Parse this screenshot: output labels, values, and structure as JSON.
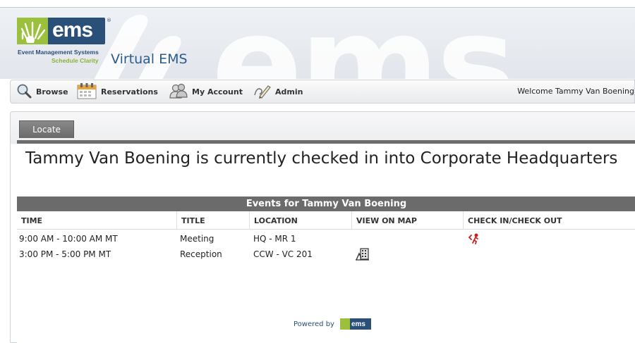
{
  "header": {
    "logo_text": "ems",
    "logo_registered": "®",
    "logo_subtitle": "Event Management Systems",
    "logo_tagline": "Schedule Clarity",
    "app_title": "Virtual EMS"
  },
  "toolbar": {
    "items": [
      {
        "label": "Browse",
        "icon": "magnifier-icon"
      },
      {
        "label": "Reservations",
        "icon": "calendar-icon"
      },
      {
        "label": "My Account",
        "icon": "people-icon"
      },
      {
        "label": "Admin",
        "icon": "pencil-icon"
      }
    ],
    "welcome": "Welcome Tammy Van Boening"
  },
  "tabs": [
    {
      "label": "Locate",
      "active": true
    }
  ],
  "status_heading": "Tammy Van Boening is currently checked in into Corporate Headquarters",
  "events": {
    "title": "Events for Tammy Van Boening",
    "columns": [
      "TIME",
      "TITLE",
      "LOCATION",
      "VIEW ON MAP",
      "CHECK IN/CHECK OUT"
    ],
    "rows": [
      {
        "time": "9:00 AM - 10:00 AM MT",
        "title": "Meeting",
        "location": "HQ - MR 1",
        "map_icon": "",
        "check_icon": "check-out-icon"
      },
      {
        "time": "3:00 PM - 5:00 PM MT",
        "title": "Reception",
        "location": "CCW - VC 201",
        "map_icon": "map-building-icon",
        "check_icon": ""
      }
    ]
  },
  "footer": {
    "powered_by": "Powered by",
    "logo_text": "ems"
  },
  "colors": {
    "brand_blue": "#2a4f79",
    "brand_green": "#9bc13c",
    "title_blue": "#2b5c8f",
    "bar_gray": "#6b6b6b",
    "check_red": "#cc1f1f"
  }
}
